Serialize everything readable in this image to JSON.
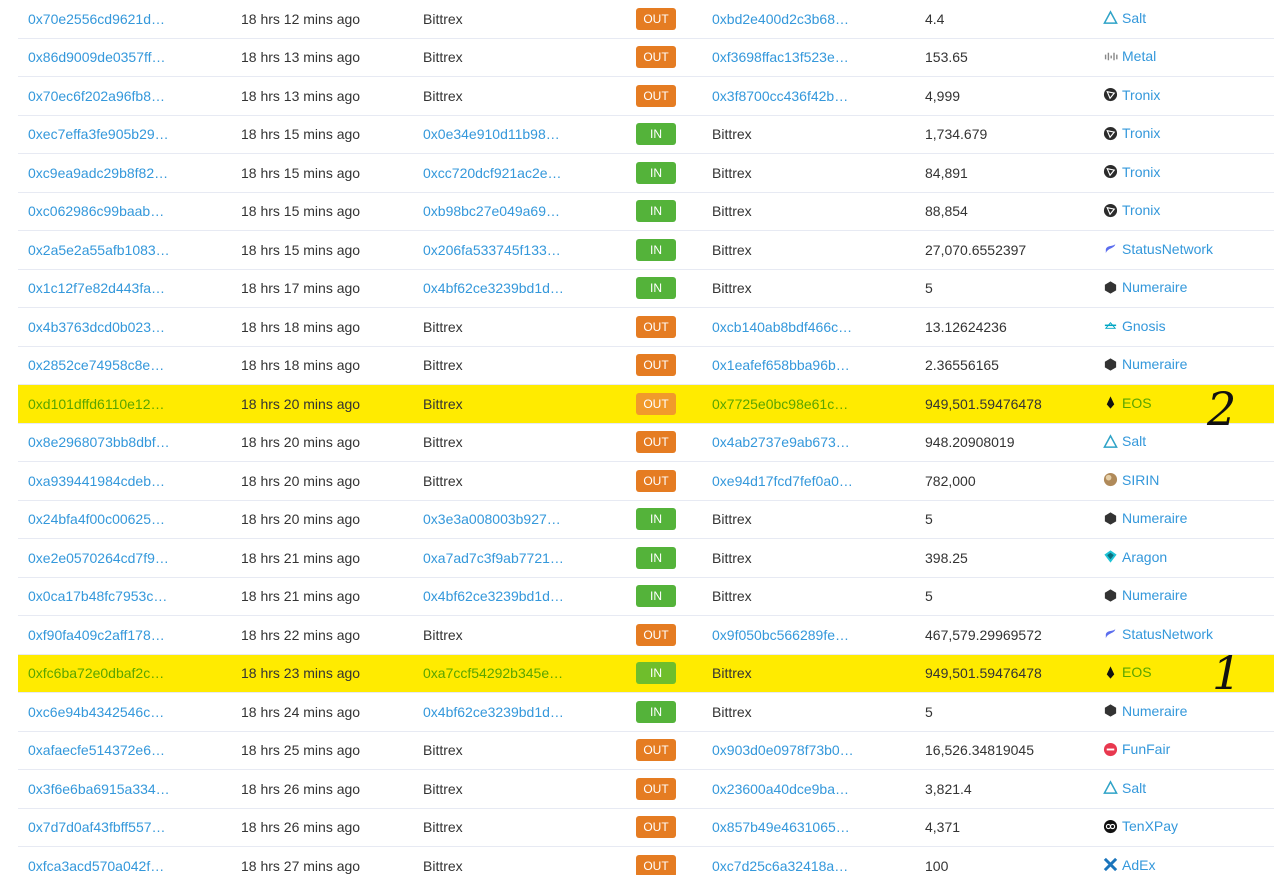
{
  "annotations": {
    "mark_top": "2",
    "mark_bottom": "1"
  },
  "colors": {
    "link": "#3498db",
    "out": "#e57c22",
    "in": "#54b33a",
    "highlight": "#ffeb00"
  },
  "rows": [
    {
      "hash": "0x70e2556cd9621d…",
      "age": "18 hrs 12 mins ago",
      "from": "Bittrex",
      "from_link": false,
      "dir": "OUT",
      "to": "0xbd2e400d2c3b68…",
      "to_link": true,
      "qty": "4.4",
      "token": "Salt",
      "icon": "salt-icon",
      "hl": false
    },
    {
      "hash": "0x86d9009de0357ff…",
      "age": "18 hrs 13 mins ago",
      "from": "Bittrex",
      "from_link": false,
      "dir": "OUT",
      "to": "0xf3698ffac13f523e…",
      "to_link": true,
      "qty": "153.65",
      "token": "Metal",
      "icon": "metal-icon",
      "hl": false
    },
    {
      "hash": "0x70ec6f202a96fb8…",
      "age": "18 hrs 13 mins ago",
      "from": "Bittrex",
      "from_link": false,
      "dir": "OUT",
      "to": "0x3f8700cc436f42b…",
      "to_link": true,
      "qty": "4,999",
      "token": "Tronix",
      "icon": "tronix-icon",
      "hl": false
    },
    {
      "hash": "0xec7effa3fe905b29…",
      "age": "18 hrs 15 mins ago",
      "from": "0x0e34e910d11b98…",
      "from_link": true,
      "dir": "IN",
      "to": "Bittrex",
      "to_link": false,
      "qty": "1,734.679",
      "token": "Tronix",
      "icon": "tronix-icon",
      "hl": false
    },
    {
      "hash": "0xc9ea9adc29b8f82…",
      "age": "18 hrs 15 mins ago",
      "from": "0xcc720dcf921ac2e…",
      "from_link": true,
      "dir": "IN",
      "to": "Bittrex",
      "to_link": false,
      "qty": "84,891",
      "token": "Tronix",
      "icon": "tronix-icon",
      "hl": false
    },
    {
      "hash": "0xc062986c99baab…",
      "age": "18 hrs 15 mins ago",
      "from": "0xb98bc27e049a69…",
      "from_link": true,
      "dir": "IN",
      "to": "Bittrex",
      "to_link": false,
      "qty": "88,854",
      "token": "Tronix",
      "icon": "tronix-icon",
      "hl": false
    },
    {
      "hash": "0x2a5e2a55afb1083…",
      "age": "18 hrs 15 mins ago",
      "from": "0x206fa533745f133…",
      "from_link": true,
      "dir": "IN",
      "to": "Bittrex",
      "to_link": false,
      "qty": "27,070.6552397",
      "token": "StatusNetwork",
      "icon": "statusnetwork-icon",
      "hl": false
    },
    {
      "hash": "0x1c12f7e82d443fa…",
      "age": "18 hrs 17 mins ago",
      "from": "0x4bf62ce3239bd1d…",
      "from_link": true,
      "dir": "IN",
      "to": "Bittrex",
      "to_link": false,
      "qty": "5",
      "token": "Numeraire",
      "icon": "numeraire-icon",
      "hl": false
    },
    {
      "hash": "0x4b3763dcd0b023…",
      "age": "18 hrs 18 mins ago",
      "from": "Bittrex",
      "from_link": false,
      "dir": "OUT",
      "to": "0xcb140ab8bdf466c…",
      "to_link": true,
      "qty": "13.12624236",
      "token": "Gnosis",
      "icon": "gnosis-icon",
      "hl": false
    },
    {
      "hash": "0x2852ce74958c8e…",
      "age": "18 hrs 18 mins ago",
      "from": "Bittrex",
      "from_link": false,
      "dir": "OUT",
      "to": "0x1eafef658bba96b…",
      "to_link": true,
      "qty": "2.36556165",
      "token": "Numeraire",
      "icon": "numeraire-icon",
      "hl": false
    },
    {
      "hash": "0xd101dffd6110e12…",
      "age": "18 hrs 20 mins ago",
      "from": "Bittrex",
      "from_link": false,
      "dir": "OUT",
      "to": "0x7725e0bc98e61c…",
      "to_link": true,
      "qty": "949,501.59476478",
      "token": "EOS",
      "icon": "eos-icon",
      "hl": true
    },
    {
      "hash": "0x8e2968073bb8dbf…",
      "age": "18 hrs 20 mins ago",
      "from": "Bittrex",
      "from_link": false,
      "dir": "OUT",
      "to": "0x4ab2737e9ab673…",
      "to_link": true,
      "qty": "948.20908019",
      "token": "Salt",
      "icon": "salt-icon",
      "hl": false
    },
    {
      "hash": "0xa939441984cdeb…",
      "age": "18 hrs 20 mins ago",
      "from": "Bittrex",
      "from_link": false,
      "dir": "OUT",
      "to": "0xe94d17fcd7fef0a0…",
      "to_link": true,
      "qty": "782,000",
      "token": "SIRIN",
      "icon": "sirin-icon",
      "hl": false
    },
    {
      "hash": "0x24bfa4f00c00625…",
      "age": "18 hrs 20 mins ago",
      "from": "0x3e3a008003b927…",
      "from_link": true,
      "dir": "IN",
      "to": "Bittrex",
      "to_link": false,
      "qty": "5",
      "token": "Numeraire",
      "icon": "numeraire-icon",
      "hl": false
    },
    {
      "hash": "0xe2e0570264cd7f9…",
      "age": "18 hrs 21 mins ago",
      "from": "0xa7ad7c3f9ab7721…",
      "from_link": true,
      "dir": "IN",
      "to": "Bittrex",
      "to_link": false,
      "qty": "398.25",
      "token": "Aragon",
      "icon": "aragon-icon",
      "hl": false
    },
    {
      "hash": "0x0ca17b48fc7953c…",
      "age": "18 hrs 21 mins ago",
      "from": "0x4bf62ce3239bd1d…",
      "from_link": true,
      "dir": "IN",
      "to": "Bittrex",
      "to_link": false,
      "qty": "5",
      "token": "Numeraire",
      "icon": "numeraire-icon",
      "hl": false
    },
    {
      "hash": "0xf90fa409c2aff178…",
      "age": "18 hrs 22 mins ago",
      "from": "Bittrex",
      "from_link": false,
      "dir": "OUT",
      "to": "0x9f050bc566289fe…",
      "to_link": true,
      "qty": "467,579.29969572",
      "token": "StatusNetwork",
      "icon": "statusnetwork-icon",
      "hl": false
    },
    {
      "hash": "0xfc6ba72e0dbaf2c…",
      "age": "18 hrs 23 mins ago",
      "from": "0xa7ccf54292b345e…",
      "from_link": true,
      "dir": "IN",
      "to": "Bittrex",
      "to_link": false,
      "qty": "949,501.59476478",
      "token": "EOS",
      "icon": "eos-icon",
      "hl": true
    },
    {
      "hash": "0xc6e94b4342546c…",
      "age": "18 hrs 24 mins ago",
      "from": "0x4bf62ce3239bd1d…",
      "from_link": true,
      "dir": "IN",
      "to": "Bittrex",
      "to_link": false,
      "qty": "5",
      "token": "Numeraire",
      "icon": "numeraire-icon",
      "hl": false
    },
    {
      "hash": "0xafaecfe514372e6…",
      "age": "18 hrs 25 mins ago",
      "from": "Bittrex",
      "from_link": false,
      "dir": "OUT",
      "to": "0x903d0e0978f73b0…",
      "to_link": true,
      "qty": "16,526.34819045",
      "token": "FunFair",
      "icon": "funfair-icon",
      "hl": false
    },
    {
      "hash": "0x3f6e6ba6915a334…",
      "age": "18 hrs 26 mins ago",
      "from": "Bittrex",
      "from_link": false,
      "dir": "OUT",
      "to": "0x23600a40dce9ba…",
      "to_link": true,
      "qty": "3,821.4",
      "token": "Salt",
      "icon": "salt-icon",
      "hl": false
    },
    {
      "hash": "0x7d7d0af43fbff557…",
      "age": "18 hrs 26 mins ago",
      "from": "Bittrex",
      "from_link": false,
      "dir": "OUT",
      "to": "0x857b49e4631065…",
      "to_link": true,
      "qty": "4,371",
      "token": "TenXPay",
      "icon": "tenxpay-icon",
      "hl": false
    },
    {
      "hash": "0xfca3acd570a042f…",
      "age": "18 hrs 27 mins ago",
      "from": "Bittrex",
      "from_link": false,
      "dir": "OUT",
      "to": "0xc7d25c6a32418a…",
      "to_link": true,
      "qty": "100",
      "token": "AdEx",
      "icon": "adex-icon",
      "hl": false
    }
  ]
}
